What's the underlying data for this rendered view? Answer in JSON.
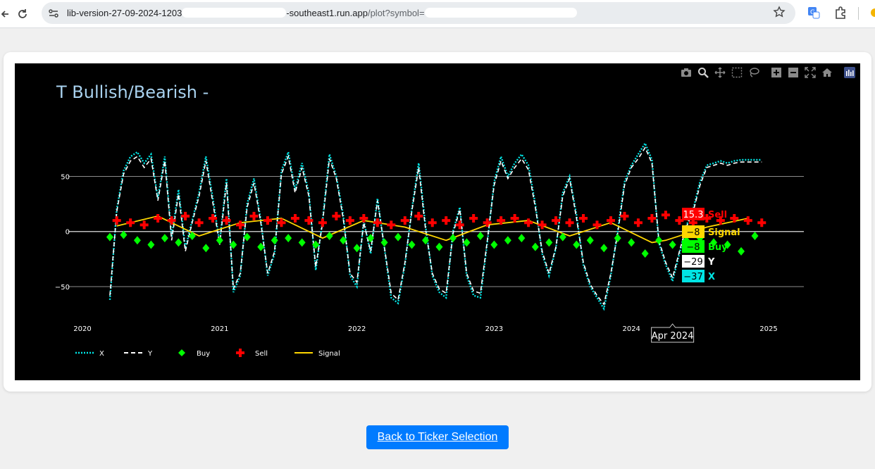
{
  "browser": {
    "url_start": "lib-version-27-09-2024-1203",
    "url_mid": "-southeast1.run.app",
    "url_path": "/plot?symbol=",
    "icons": [
      "back-arrow-icon",
      "reload-icon",
      "site-info-icon",
      "star-icon",
      "translate-icon",
      "extensions-icon"
    ]
  },
  "plot": {
    "title": "T Bullish/Bearish -",
    "modebar_icons": [
      "camera-icon",
      "zoom-icon",
      "pan-icon",
      "box-select-icon",
      "lasso-icon",
      "zoom-in-icon",
      "zoom-out-icon",
      "autoscale-icon",
      "reset-axes-icon",
      "plotly-logo-icon"
    ],
    "hover": {
      "x_label": "Apr 2024",
      "sell_value": "15.3",
      "sell_name": "Sell",
      "signal_value": "−8",
      "signal_name": "Signal",
      "buy_value": "−8",
      "buy_name": "Buy",
      "y_value": "−29",
      "y_name": "Y",
      "x_value": "−37",
      "x_name": "X"
    }
  },
  "chart_data": {
    "type": "line",
    "title": "T Bullish/Bearish -",
    "x_ticks": [
      "2020",
      "2021",
      "2022",
      "2023",
      "2024",
      "2025"
    ],
    "y_ticks": [
      "50",
      "0",
      "−50"
    ],
    "ylim": [
      -80,
      95
    ],
    "grid": "horizontal",
    "legend_position": "bottom-left",
    "legend": [
      {
        "name": "X",
        "style": "dotted",
        "color": "#00e5e5"
      },
      {
        "name": "Y",
        "style": "dashed",
        "color": "#ffffff"
      },
      {
        "name": "Buy",
        "style": "diamond",
        "color": "#00ff00"
      },
      {
        "name": "Sell",
        "style": "cross",
        "color": "#ff0000"
      },
      {
        "name": "Signal",
        "style": "line",
        "color": "#ffd700"
      }
    ],
    "series": [
      {
        "name": "X",
        "x": [
          2020.2,
          2020.25,
          2020.3,
          2020.35,
          2020.4,
          2020.45,
          2020.5,
          2020.55,
          2020.6,
          2020.65,
          2020.7,
          2020.75,
          2020.8,
          2020.85,
          2020.9,
          2020.95,
          2021.0,
          2021.05,
          2021.1,
          2021.15,
          2021.2,
          2021.25,
          2021.3,
          2021.35,
          2021.4,
          2021.45,
          2021.5,
          2021.55,
          2021.6,
          2021.65,
          2021.7,
          2021.75,
          2021.8,
          2021.85,
          2021.9,
          2021.95,
          2022.0,
          2022.05,
          2022.1,
          2022.15,
          2022.2,
          2022.25,
          2022.3,
          2022.35,
          2022.4,
          2022.45,
          2022.5,
          2022.55,
          2022.6,
          2022.65,
          2022.7,
          2022.75,
          2022.8,
          2022.85,
          2022.9,
          2022.95,
          2023.0,
          2023.05,
          2023.1,
          2023.15,
          2023.2,
          2023.25,
          2023.3,
          2023.35,
          2023.4,
          2023.45,
          2023.5,
          2023.55,
          2023.6,
          2023.65,
          2023.7,
          2023.75,
          2023.8,
          2023.85,
          2023.9,
          2023.95,
          2024.0,
          2024.05,
          2024.1,
          2024.15,
          2024.2,
          2024.25,
          2024.3,
          2024.35,
          2024.4,
          2024.45,
          2024.5,
          2024.55,
          2024.6,
          2024.65,
          2024.7,
          2024.75,
          2024.8,
          2024.85,
          2024.9,
          2024.95
        ],
        "y": [
          -62,
          20,
          55,
          68,
          72,
          62,
          70,
          30,
          68,
          -5,
          38,
          -15,
          10,
          35,
          68,
          30,
          -10,
          48,
          -55,
          -40,
          25,
          48,
          10,
          -40,
          -20,
          55,
          72,
          38,
          62,
          35,
          -35,
          10,
          70,
          50,
          15,
          -40,
          -50,
          10,
          -20,
          30,
          -15,
          -60,
          -65,
          -30,
          20,
          62,
          5,
          -40,
          -55,
          -60,
          0,
          22,
          -40,
          -58,
          -60,
          -10,
          45,
          68,
          50,
          62,
          70,
          60,
          25,
          -20,
          -40,
          -15,
          35,
          50,
          15,
          -30,
          -50,
          -60,
          -70,
          -40,
          0,
          45,
          60,
          70,
          80,
          65,
          -10,
          -30,
          -45,
          -20,
          5,
          20,
          45,
          60,
          62,
          64,
          62,
          64,
          65,
          65,
          65,
          65
        ],
        "color": "#00e5e5"
      },
      {
        "name": "Y",
        "x": [
          2020.2,
          2020.25,
          2020.3,
          2020.35,
          2020.4,
          2020.45,
          2020.5,
          2020.55,
          2020.6,
          2020.65,
          2020.7,
          2020.75,
          2020.8,
          2020.85,
          2020.9,
          2020.95,
          2021.0,
          2021.05,
          2021.1,
          2021.15,
          2021.2,
          2021.25,
          2021.3,
          2021.35,
          2021.4,
          2021.45,
          2021.5,
          2021.55,
          2021.6,
          2021.65,
          2021.7,
          2021.75,
          2021.8,
          2021.85,
          2021.9,
          2021.95,
          2022.0,
          2022.05,
          2022.1,
          2022.15,
          2022.2,
          2022.25,
          2022.3,
          2022.35,
          2022.4,
          2022.45,
          2022.5,
          2022.55,
          2022.6,
          2022.65,
          2022.7,
          2022.75,
          2022.8,
          2022.85,
          2022.9,
          2022.95,
          2023.0,
          2023.05,
          2023.1,
          2023.15,
          2023.2,
          2023.25,
          2023.3,
          2023.35,
          2023.4,
          2023.45,
          2023.5,
          2023.55,
          2023.6,
          2023.65,
          2023.7,
          2023.75,
          2023.8,
          2023.85,
          2023.9,
          2023.95,
          2024.0,
          2024.05,
          2024.1,
          2024.15,
          2024.2,
          2024.25,
          2024.3,
          2024.35,
          2024.4,
          2024.45,
          2024.5,
          2024.55,
          2024.6,
          2024.65,
          2024.7,
          2024.75,
          2024.8,
          2024.85,
          2024.9,
          2024.95
        ],
        "y": [
          -58,
          18,
          52,
          64,
          68,
          58,
          66,
          28,
          64,
          -8,
          34,
          -18,
          8,
          32,
          64,
          26,
          -12,
          44,
          -52,
          -38,
          22,
          44,
          8,
          -38,
          -18,
          52,
          68,
          35,
          58,
          32,
          -32,
          8,
          66,
          48,
          12,
          -38,
          -46,
          8,
          -18,
          28,
          -14,
          -56,
          -62,
          -28,
          18,
          58,
          2,
          -38,
          -52,
          -56,
          -2,
          20,
          -38,
          -54,
          -56,
          -8,
          42,
          64,
          48,
          58,
          66,
          56,
          22,
          -18,
          -38,
          -14,
          32,
          48,
          12,
          -28,
          -48,
          -58,
          -66,
          -38,
          -2,
          42,
          58,
          66,
          76,
          62,
          -8,
          -28,
          -42,
          -18,
          4,
          18,
          42,
          58,
          60,
          62,
          60,
          62,
          63,
          63,
          63,
          63
        ],
        "color": "#ffffff"
      },
      {
        "name": "Sell",
        "x": [
          2020.25,
          2020.35,
          2020.45,
          2020.55,
          2020.65,
          2020.75,
          2020.85,
          2020.95,
          2021.05,
          2021.15,
          2021.25,
          2021.35,
          2021.45,
          2021.55,
          2021.65,
          2021.75,
          2021.85,
          2021.95,
          2022.05,
          2022.15,
          2022.25,
          2022.35,
          2022.45,
          2022.55,
          2022.65,
          2022.75,
          2022.85,
          2022.95,
          2023.05,
          2023.15,
          2023.25,
          2023.35,
          2023.45,
          2023.55,
          2023.65,
          2023.75,
          2023.85,
          2023.95,
          2024.05,
          2024.15,
          2024.25,
          2024.35,
          2024.45,
          2024.55,
          2024.65,
          2024.75,
          2024.85,
          2024.95
        ],
        "y": [
          10,
          8,
          6,
          12,
          10,
          14,
          8,
          12,
          10,
          6,
          14,
          10,
          8,
          12,
          10,
          8,
          14,
          10,
          12,
          8,
          6,
          10,
          14,
          8,
          10,
          6,
          12,
          8,
          10,
          12,
          8,
          6,
          10,
          8,
          12,
          6,
          10,
          14,
          8,
          12,
          15,
          10,
          8,
          12,
          10,
          12,
          10,
          8
        ],
        "color": "#ff0000"
      },
      {
        "name": "Buy",
        "x": [
          2020.2,
          2020.3,
          2020.4,
          2020.5,
          2020.6,
          2020.7,
          2020.8,
          2020.9,
          2021.0,
          2021.1,
          2021.2,
          2021.3,
          2021.4,
          2021.5,
          2021.6,
          2021.7,
          2021.8,
          2021.9,
          2022.0,
          2022.1,
          2022.2,
          2022.3,
          2022.4,
          2022.5,
          2022.6,
          2022.7,
          2022.8,
          2022.9,
          2023.0,
          2023.1,
          2023.2,
          2023.3,
          2023.4,
          2023.5,
          2023.6,
          2023.7,
          2023.8,
          2023.9,
          2024.0,
          2024.1,
          2024.2,
          2024.3,
          2024.4,
          2024.5,
          2024.6,
          2024.7,
          2024.8,
          2024.9
        ],
        "y": [
          -5,
          -3,
          -8,
          -12,
          -6,
          -10,
          -4,
          -15,
          -8,
          -12,
          -5,
          -14,
          -8,
          -6,
          -10,
          -12,
          -4,
          -8,
          -15,
          -6,
          -10,
          -5,
          -12,
          -8,
          -14,
          -6,
          -10,
          -4,
          -12,
          -8,
          -6,
          -14,
          -10,
          -5,
          -12,
          -8,
          -15,
          -6,
          -10,
          -20,
          -8,
          -12,
          -8,
          -6,
          -10,
          -12,
          -18,
          -4
        ],
        "color": "#00ff00"
      },
      {
        "name": "Signal",
        "x": [
          2020.25,
          2020.55,
          2020.85,
          2021.15,
          2021.45,
          2021.75,
          2022.05,
          2022.35,
          2022.65,
          2022.95,
          2023.25,
          2023.55,
          2023.85,
          2024.15,
          2024.25,
          2024.55,
          2024.85
        ],
        "y": [
          5,
          14,
          -4,
          8,
          12,
          -6,
          10,
          4,
          -8,
          6,
          10,
          -4,
          8,
          -10,
          -8,
          4,
          12
        ],
        "color": "#ffd700"
      }
    ]
  },
  "back_button": {
    "label": "Back to Ticker Selection"
  }
}
